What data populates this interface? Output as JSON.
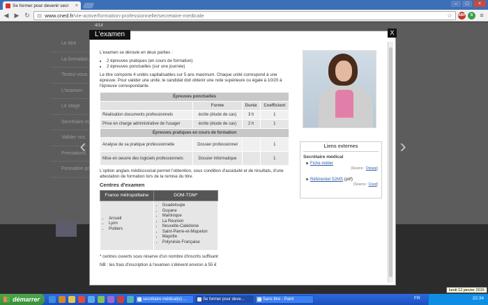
{
  "browser": {
    "tab_title": "Se former pour devenir secr",
    "tab_close": "×",
    "url_host": "www.cned.fr",
    "url_path": "/vie-active/formation-professionnelle/secretaire-medicale",
    "win_min": "–",
    "win_max": "□",
    "win_close": "×"
  },
  "page": {
    "side_menu": [
      "Le titre",
      "La formation",
      "Testez-vous",
      "L'examen",
      "Le stage",
      "Secrétaire m",
      "Valider vos",
      "Prestations",
      "Formation pro"
    ],
    "arrow_left": "‹",
    "arrow_right": "›"
  },
  "modal": {
    "counter": "4/14",
    "title": "L'examen",
    "close": "X",
    "intro": "L'examen se déroule en deux parties :",
    "intro_items": [
      "2 épreuves pratiques (en cours de formation)",
      "2 épreuves ponctuelles (sur une journée)"
    ],
    "description": "Le titre comporte 4 unités capitalisables sur 5 ans maximum. Chaque unité correspond à une épreuve. Pour valider une unité, le candidat doit obtenir une note supérieure ou égale à 10/20 à l'épreuve correspondante.",
    "table": {
      "section1": "Épreuves ponctuelles",
      "headers": [
        "Forme",
        "Durée",
        "Coefficient"
      ],
      "section1_rows": [
        {
          "name": "Réalisation documents professionnels",
          "forme": "écrite (étude de cas)",
          "duree": "3 h",
          "coef": "1"
        },
        {
          "name": "Prise en charge administrative de l'usager",
          "forme": "écrite (étude de cas)",
          "duree": "2 h",
          "coef": "1"
        }
      ],
      "section2": "Épreuves pratiques en cours de formation",
      "section2_rows": [
        {
          "name": "Analyse de sa pratique professionnelle",
          "forme": "Dossier professionnel",
          "duree": "",
          "coef": "1"
        },
        {
          "name": "Mise en oeuvre des logiciels professionnels",
          "forme": "Dossier informatique",
          "duree": "",
          "coef": "1"
        }
      ]
    },
    "option_text": "L'option anglais médicosocial permet l'obtention, sous condition d'assiduité et de résultats, d'une attestation de formation lors de la remise du titre.",
    "centres_title": "Centres d'examen",
    "centres_headers": [
      "France métropolitaine",
      "DOM-TOM*"
    ],
    "centres_france": [
      "Arcueil",
      "Lyon",
      "Poitiers"
    ],
    "centres_domtom": [
      "Guadeloupe",
      "Guyane",
      "Martinique",
      "La Réunion",
      "Nouvelle-Calédonie",
      "Saint-Pierre-et-Miquelon",
      "Mayotte",
      "Polynésie Française"
    ],
    "footnote": "* centres ouverts sous réserve d'un nombre d'inscrits suffisant",
    "fees": "NB : les frais d'inscription à l'examen s'élèvent environ à 55 €",
    "links": {
      "title": "Liens externes",
      "subtitle": "Secrétaire médical",
      "link1": "Fiche métier",
      "source1_label": "[Source :",
      "source1_link": "Onisep",
      "source1_end": "]",
      "link2": "Référentiel S2MS",
      "link2_suffix": "(pdf)",
      "source2_label": "[Source :",
      "source2_link": "Cned",
      "source2_end": "]"
    }
  },
  "taskbar": {
    "start": "démarrer",
    "buttons": [
      "secrétaire médical(e) ...",
      "Se former pour deve...",
      "Sans titre - Paint"
    ],
    "lang": "FR",
    "clock": "22:34",
    "tooltip": "lundi 12 janvier 2015"
  }
}
